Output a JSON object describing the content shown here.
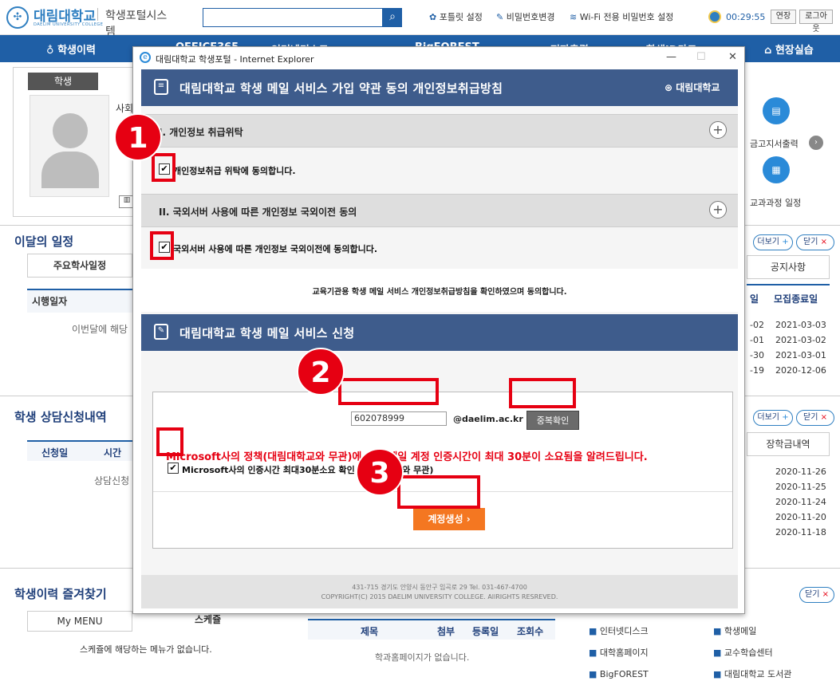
{
  "header": {
    "logo_text": "대림대학교",
    "logo_sub": "DAELIM UNIVERSITY COLLEGE",
    "portal_title": "학생포털시스템",
    "search_placeholder": "",
    "links": [
      "포틀릿 설정",
      "비밀번호변경",
      "Wi-Fi 전용 비밀번호 설정"
    ],
    "timer": "00:29:55",
    "extend_label": "연장",
    "logout_label": "로그아웃"
  },
  "nav": {
    "items": [
      "학생이력",
      "OFFICE365",
      "인터넷디스크",
      "BigFOREST",
      "전자출결",
      "학생ID카드",
      "현장실습"
    ]
  },
  "background": {
    "student_tab": "학생",
    "student_partial": "사회",
    "right_icon1_label": "금고지서출력",
    "right_icon2_label": "교과과정 일정",
    "month_schedule_title": "이달의 일정",
    "academic_tab": "주요학사일정",
    "exec_date_header": "시행일자",
    "no_schedule": "이번달에 해당",
    "more_label": "더보기",
    "close_label": "닫기",
    "notice_tab": "공지사항",
    "recruit_header_partial": "일",
    "recruit_end_header": "모집종료일",
    "recruit_rows": [
      {
        "start": "-02",
        "end": "2021-03-03"
      },
      {
        "start": "-01",
        "end": "2021-03-02"
      },
      {
        "start": "-30",
        "end": "2021-03-01"
      },
      {
        "start": "-19",
        "end": "2020-12-06"
      }
    ],
    "counsel_title": "학생 상담신청내역",
    "counsel_cols": [
      "신청일",
      "시간"
    ],
    "counsel_empty": "상담신청",
    "scholarship_tab": "장학금내역",
    "scholarship_dates": [
      "2020-11-26",
      "2020-11-25",
      "2020-11-24",
      "2020-11-20",
      "2020-11-18"
    ],
    "fav_title": "학생이력 즐겨찾기",
    "my_menu": "My MENU",
    "schedule_tab": "스케쥴",
    "no_menu": "스케쥴에 해당하는 메뉴가 없습니다.",
    "dept_cols": [
      "제목",
      "첨부",
      "등록일",
      "조회수"
    ],
    "dept_empty": "학과홈페이지가 없습니다.",
    "quick_links": [
      "인터넷디스크",
      "학생메일",
      "대학홈페이지",
      "교수학습센터",
      "BigFOREST",
      "대림대학교 도서관"
    ]
  },
  "popup": {
    "window_title": "대림대학교 학생포털 - Internet Explorer",
    "banner_title": "대림대학교 학생 메일 서비스 가입 약관 동의 개인정보취급방침",
    "banner_logo": "대림대학교",
    "section1_title": "I. 개인정보 취급위탁",
    "section1_check": "개인정보취급 위탁에 동의합니다.",
    "section2_title": "II. 국외서버 사용에 따른 개인정보 국외이전 동의",
    "section2_check": "국외서버 사용에 따른 개인정보 국외이전에 동의합니다.",
    "confirm_text": "교육기관용 학생 메일 서비스 개인정보취급방침을 확인하였으며 동의합니다.",
    "signup_title": "대림대학교 학생 메일 서비스 신청",
    "account_value": "602078999",
    "domain": "@daelim.ac.kr",
    "dup_check": "중복확인",
    "ms_notice": "Microsoft사의 정책(대림대학교와 무관)에 의해 메일 계정 인증시간이 최대 30분이 소요됨을 알려드립니다.",
    "ms_check": "Microsoft사의 인증시간 최대30분소요 확인 (대림대학교와 무관)",
    "create_button": "계정생성",
    "footer_address": "431-715 경기도 안양시 동안구 임곡로 29 Tel. 031-467-4700",
    "footer_copy": "COPYRIGHT(C) 2015 DAELIM UNIVERSITY COLLEGE. AllRIGHTS RESREVED."
  },
  "annotations": {
    "step1": "1",
    "step2": "2",
    "step3": "3",
    "highlight_color": "#e60012"
  }
}
